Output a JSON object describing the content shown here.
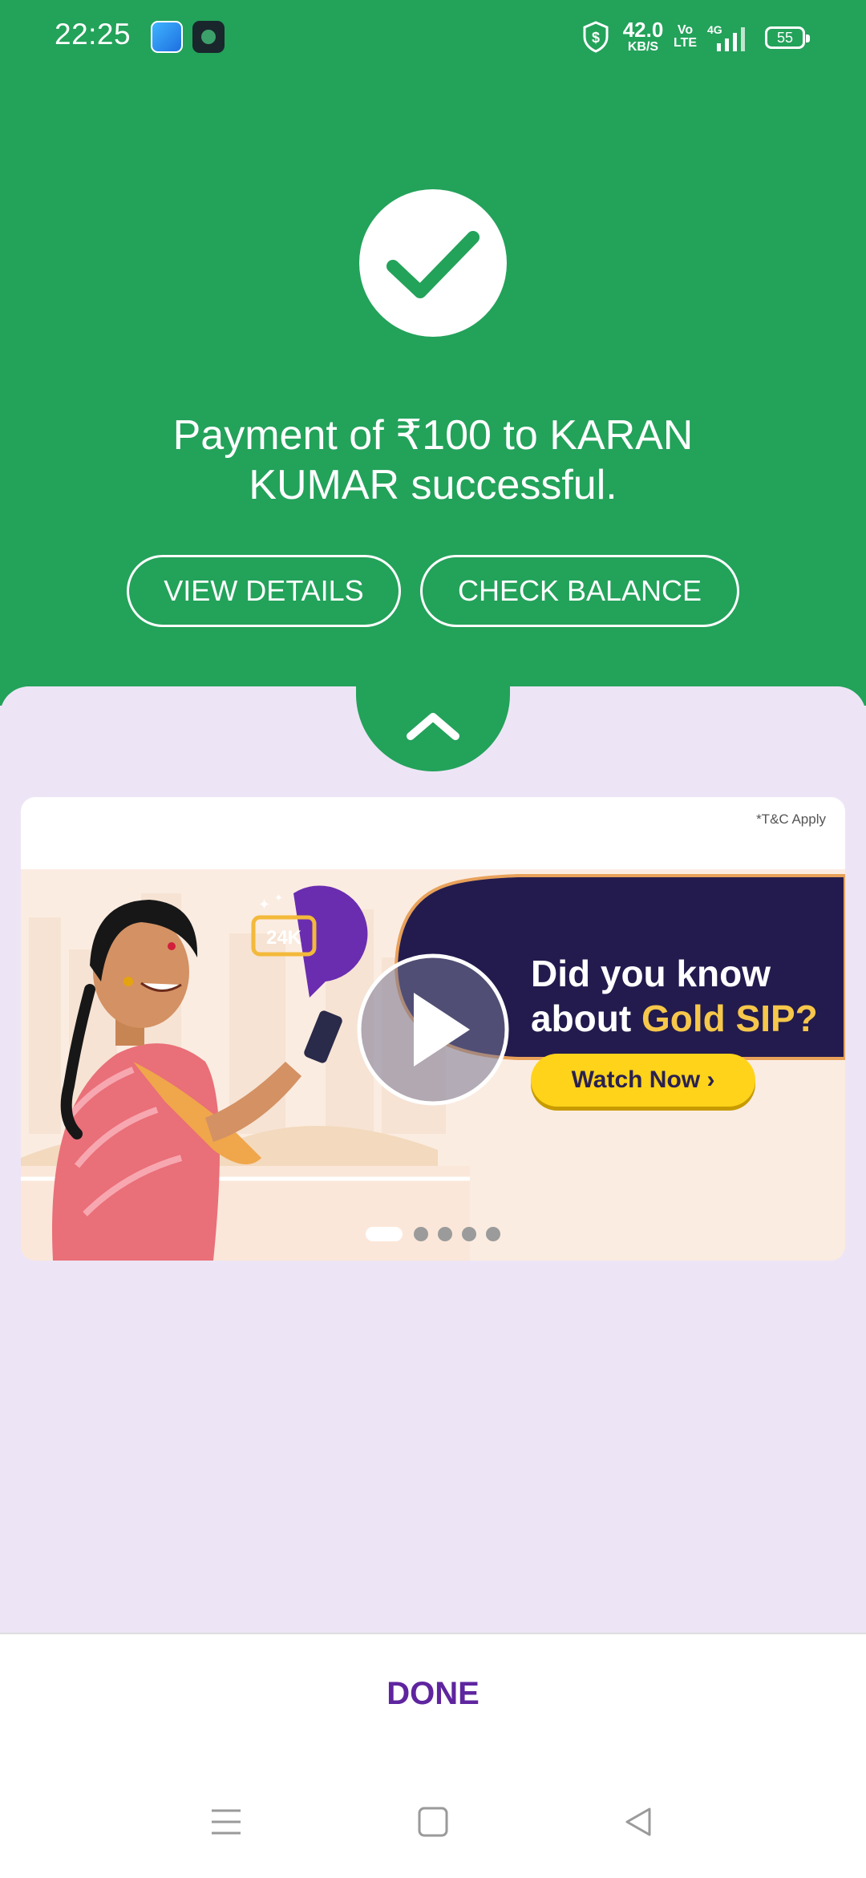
{
  "status_bar": {
    "time": "22:25",
    "net_speed_value": "42.0",
    "net_speed_unit": "KB/S",
    "volte_top": "Vo",
    "volte_bottom": "LTE",
    "network": "4G",
    "battery": "55"
  },
  "success": {
    "message": "Payment of ₹100 to KARAN KUMAR successful.",
    "view_details_label": "VIEW DETAILS",
    "check_balance_label": "CHECK BALANCE"
  },
  "banner": {
    "tnc": "*T&C Apply",
    "badge": "24K",
    "headline_line1": "Did you know",
    "headline_line2_prefix": "about ",
    "headline_line2_highlight": "Gold SIP?",
    "cta_label": "Watch Now ›",
    "pager_count": 5,
    "pager_active": 1
  },
  "footer": {
    "done_label": "DONE"
  },
  "colors": {
    "success_green": "#23a25a",
    "sheet_lavender": "#ede5f6",
    "brand_purple": "#5f259f",
    "banner_navy": "#231b4e",
    "cta_yellow": "#ffd31a"
  },
  "icons": {
    "status": [
      "app-icon-blue",
      "app-icon-dark",
      "shield-icon",
      "signal-icon",
      "battery-icon"
    ],
    "success": "checkmark-icon",
    "collapse": "chevron-up-icon",
    "play": "play-icon",
    "nav": [
      "menu-icon",
      "home-icon",
      "back-icon"
    ]
  }
}
